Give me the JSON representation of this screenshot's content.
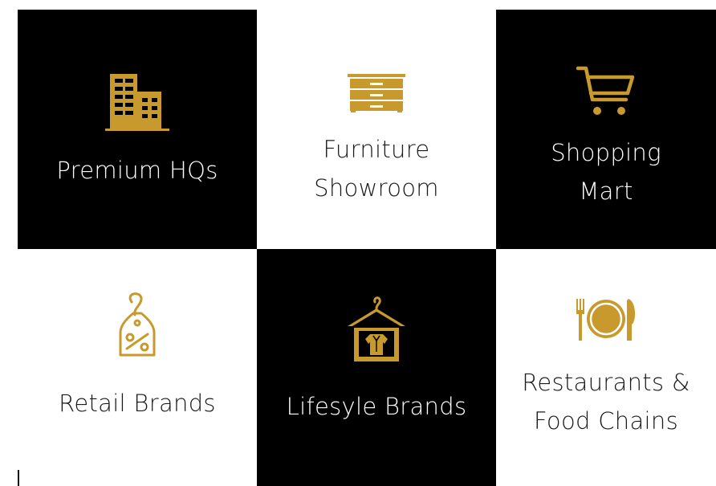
{
  "colors": {
    "dark": "#000000",
    "light": "#ffffff",
    "gold": "#C89A2E"
  },
  "tiles": [
    {
      "icon": "office-building-icon",
      "lines": [
        "Premium HQs"
      ]
    },
    {
      "icon": "dresser-icon",
      "lines": [
        "Furniture",
        "Showroom"
      ]
    },
    {
      "icon": "shopping-cart-icon",
      "lines": [
        "Shopping",
        "Mart"
      ]
    },
    {
      "icon": "price-tag-percent-icon",
      "lines": [
        "Retail Brands"
      ]
    },
    {
      "icon": "clothes-hanger-icon",
      "lines": [
        "Lifesyle Brands"
      ]
    },
    {
      "icon": "plate-cutlery-icon",
      "lines": [
        "Restaurants &",
        "Food Chains"
      ]
    }
  ]
}
